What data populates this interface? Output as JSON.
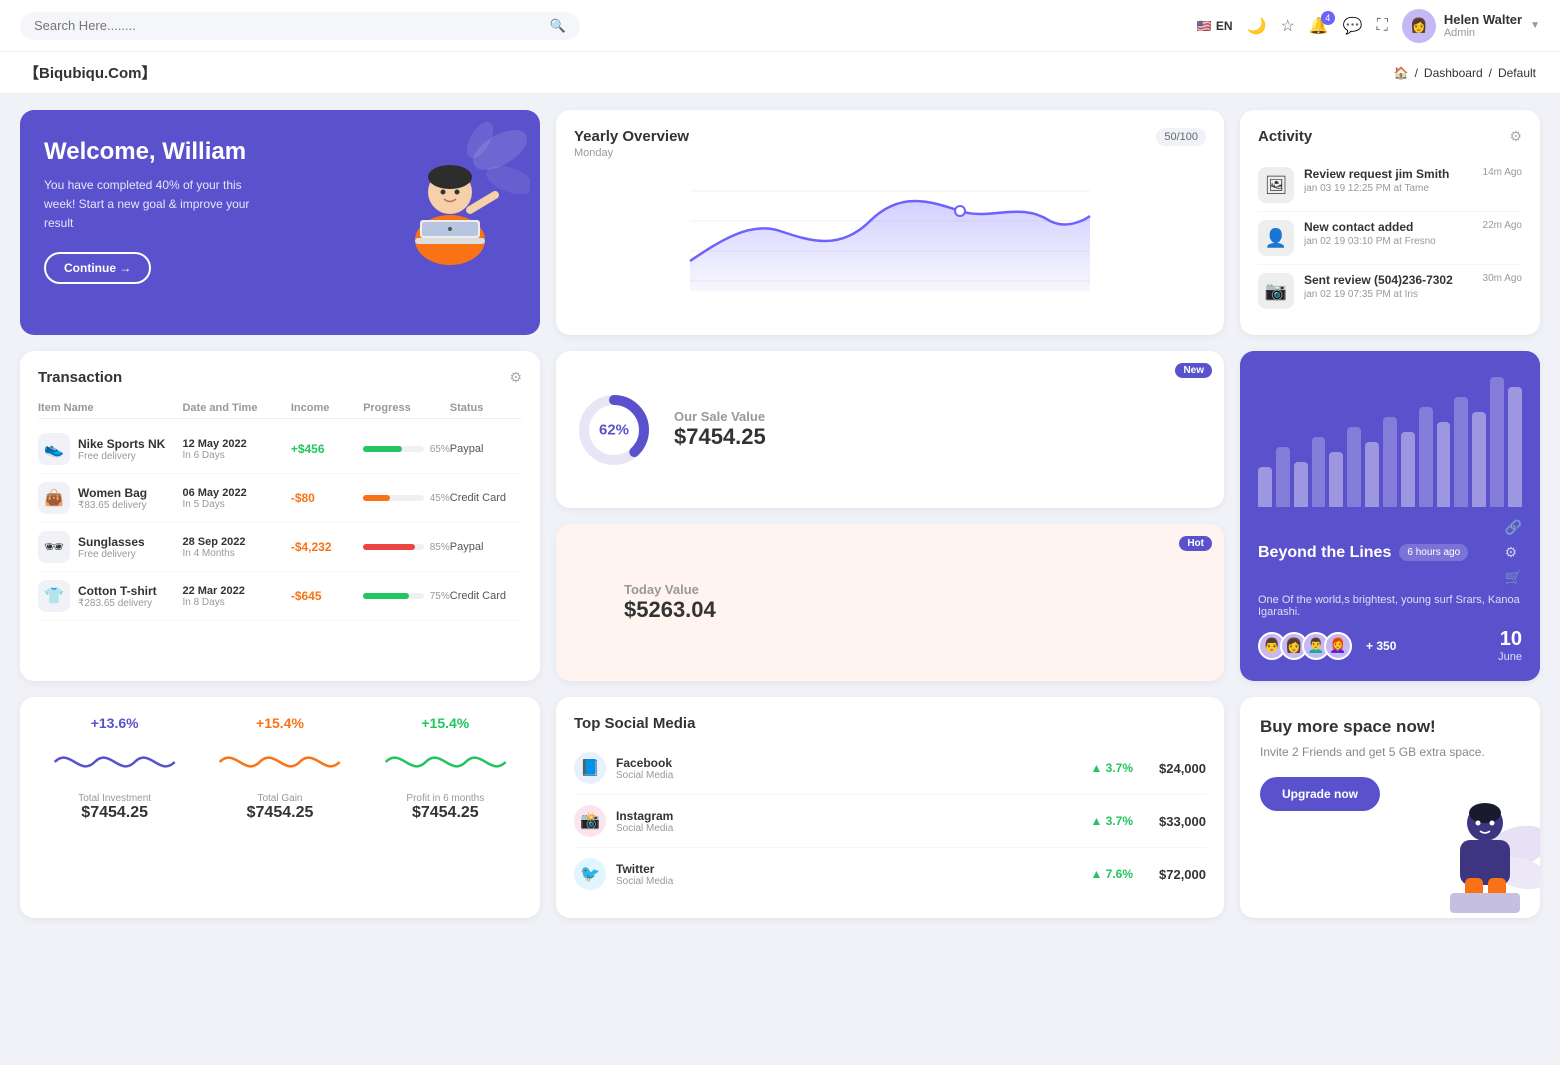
{
  "topnav": {
    "search_placeholder": "Search Here........",
    "lang": "EN",
    "user_name": "Helen Walter",
    "user_role": "Admin",
    "notification_count": "4"
  },
  "breadcrumb": {
    "brand": "【Biqubiqu.Com】",
    "home": "⌂",
    "path": "Dashboard",
    "current": "Default"
  },
  "welcome": {
    "title": "Welcome, William",
    "subtitle": "You have completed 40% of your this week! Start a new goal & improve your result",
    "button": "Continue →"
  },
  "yearly_overview": {
    "title": "Yearly Overview",
    "subtitle": "Monday",
    "progress": "50/100"
  },
  "activity": {
    "title": "Activity",
    "items": [
      {
        "title": "Review request jim Smith",
        "sub": "jan 03 19 12:25 PM at Tame",
        "time": "14m Ago",
        "emoji": "🖼"
      },
      {
        "title": "New contact added",
        "sub": "jan 02 19 03:10 PM at Fresno",
        "time": "22m Ago",
        "emoji": "👤"
      },
      {
        "title": "Sent review (504)236-7302",
        "sub": "jan 02 19 07:35 PM at Iris",
        "time": "30m Ago",
        "emoji": "📷"
      }
    ]
  },
  "transaction": {
    "title": "Transaction",
    "col_headers": [
      "Item Name",
      "Date and Time",
      "Income",
      "Progress",
      "Status"
    ],
    "rows": [
      {
        "name": "Nike Sports NK",
        "sub": "Free delivery",
        "date": "12 May 2022",
        "days": "In 6 Days",
        "income": "+$456",
        "income_type": "pos",
        "progress": 65,
        "progress_color": "#22c55e",
        "status": "Paypal",
        "emoji": "👟"
      },
      {
        "name": "Women Bag",
        "sub": "₹83.65 delivery",
        "date": "06 May 2022",
        "days": "In 5 Days",
        "income": "-$80",
        "income_type": "neg",
        "progress": 45,
        "progress_color": "#f97316",
        "status": "Credit Card",
        "emoji": "👜"
      },
      {
        "name": "Sunglasses",
        "sub": "Free delivery",
        "date": "28 Sep 2022",
        "days": "In 4 Months",
        "income": "-$4,232",
        "income_type": "neg",
        "progress": 85,
        "progress_color": "#ef4444",
        "status": "Paypal",
        "emoji": "🕶"
      },
      {
        "name": "Cotton T-shirt",
        "sub": "₹283.65 delivery",
        "date": "22 Mar 2022",
        "days": "In 8 Days",
        "income": "-$645",
        "income_type": "neg",
        "progress": 75,
        "progress_color": "#22c55e",
        "status": "Credit Card",
        "emoji": "👕"
      }
    ]
  },
  "sale_value": {
    "title": "Our Sale Value",
    "value": "$7454.25",
    "percent": "62%",
    "badge": "New"
  },
  "today_value": {
    "title": "Today Value",
    "value": "$5263.04",
    "badge": "Hot"
  },
  "bar_chart": {
    "title": "Beyond the Lines",
    "time_ago": "6 hours ago",
    "desc": "One Of the world,s brightest, young surf Srars, Kanoa Igarashi.",
    "plus_count": "+ 350",
    "event_date_num": "10",
    "event_date_month": "June",
    "bars": [
      40,
      60,
      45,
      70,
      55,
      80,
      65,
      90,
      75,
      100,
      85,
      110,
      95,
      130,
      120
    ]
  },
  "stats": [
    {
      "pct": "+13.6%",
      "color": "blue",
      "label": "Total Investment",
      "value": "$7454.25"
    },
    {
      "pct": "+15.4%",
      "color": "orange",
      "label": "Total Gain",
      "value": "$7454.25"
    },
    {
      "pct": "+15.4%",
      "color": "green",
      "label": "Profit in 6 months",
      "value": "$7454.25"
    }
  ],
  "social": {
    "title": "Top Social Media",
    "rows": [
      {
        "name": "Facebook",
        "type": "Social Media",
        "growth": "3.7%",
        "amount": "$24,000",
        "color": "#1877f2",
        "icon": "f"
      },
      {
        "name": "Instagram",
        "type": "Social Media",
        "growth": "3.7%",
        "amount": "$33,000",
        "color": "#e1306c",
        "icon": "📷"
      },
      {
        "name": "Twitter",
        "type": "Social Media",
        "growth": "7.6%",
        "amount": "$72,000",
        "color": "#1da1f2",
        "icon": "🐦"
      }
    ]
  },
  "upgrade": {
    "title": "Buy more space now!",
    "subtitle": "Invite 2 Friends and get 5 GB extra space.",
    "button": "Upgrade now"
  }
}
